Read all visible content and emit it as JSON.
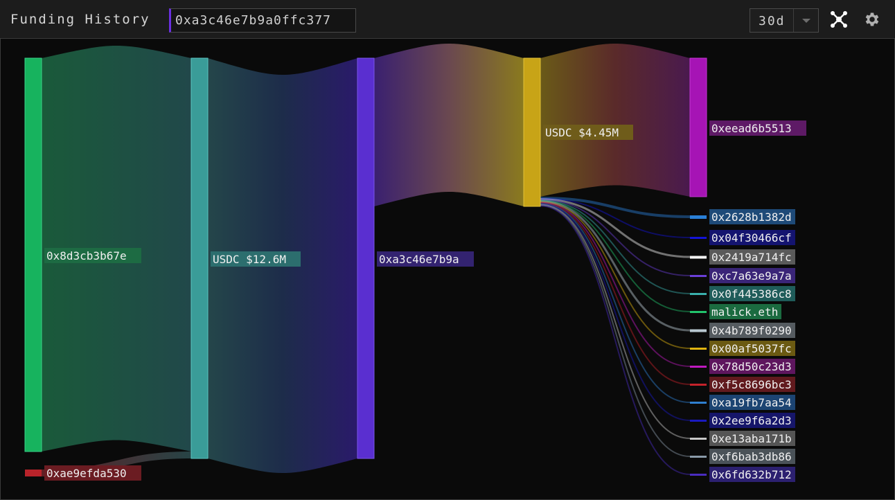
{
  "toolbar": {
    "title": "Funding History",
    "address_value": "0xa3c46e7b9a0ffc377",
    "period": "30d"
  },
  "icons": [
    "network-icon",
    "gear-icon"
  ],
  "chart_data": {
    "type": "sankey",
    "nodes": [
      {
        "id": "n_8d3",
        "label": "0x8d3cb3b67e",
        "color": "#17b35e",
        "label_bg": "#1d6b43"
      },
      {
        "id": "n_ae9",
        "label": "0xae9efda530",
        "color": "#b8232a",
        "label_bg": "#6b1c22"
      },
      {
        "id": "n_usdc1",
        "label": "USDC $12.6M",
        "color": "#3a9c98",
        "label_bg": "#2c6e6e"
      },
      {
        "id": "n_a3c",
        "label": "0xa3c46e7b9a",
        "color": "#5a2fd0",
        "label_bg": "#332370"
      },
      {
        "id": "n_usdc2",
        "label": "USDC $4.45M",
        "color": "#c8a417",
        "label_bg": "#6f5c1a"
      },
      {
        "id": "n_eea",
        "label": "0xeead6b5513",
        "color": "#a614b5",
        "label_bg": "#5e1a66"
      },
      {
        "id": "n_262",
        "label": "0x2628b1382d",
        "color": "#2a7fd6",
        "label_bg": "#1e4a78"
      },
      {
        "id": "n_04f",
        "label": "0x04f30466cf",
        "color": "#1414d8",
        "label_bg": "#141470"
      },
      {
        "id": "n_241",
        "label": "0x2419a714fc",
        "color": "#f2f2f2",
        "label_bg": "#5a5a5a"
      },
      {
        "id": "n_c7a",
        "label": "0xc7a63e9a7a",
        "color": "#6a3fd8",
        "label_bg": "#3a2578"
      },
      {
        "id": "n_0f4",
        "label": "0x0f445386c8",
        "color": "#3ab0ac",
        "label_bg": "#1f5c5a"
      },
      {
        "id": "n_mal",
        "label": "malick.eth",
        "color": "#22c46c",
        "label_bg": "#1b6b40"
      },
      {
        "id": "n_4b7",
        "label": "0x4b789f0290",
        "color": "#b8c8d0",
        "label_bg": "#555b60"
      },
      {
        "id": "n_00a",
        "label": "0x00af5037fc",
        "color": "#e0b410",
        "label_bg": "#6b5a12"
      },
      {
        "id": "n_78d",
        "label": "0x78d50c23d3",
        "color": "#c01ac0",
        "label_bg": "#5e165e"
      },
      {
        "id": "n_f5c",
        "label": "0xf5c8696bc3",
        "color": "#c4222a",
        "label_bg": "#611a1e"
      },
      {
        "id": "n_a19",
        "label": "0xa19fb7aa54",
        "color": "#2f7fd0",
        "label_bg": "#1c4472"
      },
      {
        "id": "n_2ee",
        "label": "0x2ee9f6a2d3",
        "color": "#1a1ac0",
        "label_bg": "#16166a"
      },
      {
        "id": "n_e13",
        "label": "0xe13aba171b",
        "color": "#c8c8c8",
        "label_bg": "#555555"
      },
      {
        "id": "n_f6b",
        "label": "0xf6bab3db86",
        "color": "#8a9aa8",
        "label_bg": "#4a5258"
      },
      {
        "id": "n_6fd",
        "label": "0x6fd632b712",
        "color": "#4a2cc0",
        "label_bg": "#2c2070"
      }
    ]
  }
}
